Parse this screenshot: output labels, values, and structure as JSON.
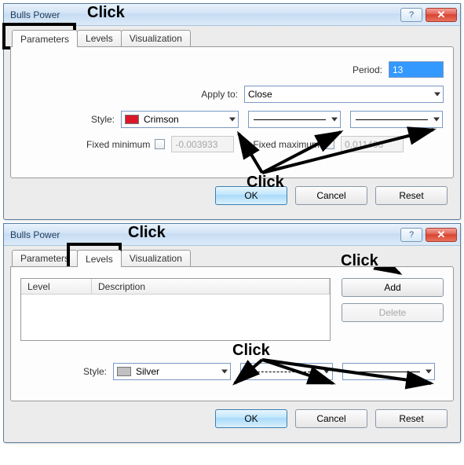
{
  "dialog1": {
    "title": "Bulls Power",
    "tabs": {
      "parameters": "Parameters",
      "levels": "Levels",
      "visualization": "Visualization"
    },
    "period": {
      "label": "Period:",
      "value": "13"
    },
    "apply_to": {
      "label": "Apply to:",
      "value": "Close"
    },
    "style": {
      "label": "Style:",
      "color_name": "Crimson",
      "color_hex": "#d9182a"
    },
    "fixed_min": {
      "label": "Fixed minimum",
      "value": "-0.003933"
    },
    "fixed_max": {
      "label": "Fixed maximum",
      "value": "0.011406"
    },
    "buttons": {
      "ok": "OK",
      "cancel": "Cancel",
      "reset": "Reset"
    }
  },
  "dialog2": {
    "title": "Bulls Power",
    "tabs": {
      "parameters": "Parameters",
      "levels": "Levels",
      "visualization": "Visualization"
    },
    "list_headers": {
      "level": "Level",
      "description": "Description"
    },
    "side_buttons": {
      "add": "Add",
      "delete": "Delete"
    },
    "style": {
      "label": "Style:",
      "color_name": "Silver",
      "color_hex": "#c0c0c0"
    },
    "buttons": {
      "ok": "OK",
      "cancel": "Cancel",
      "reset": "Reset"
    }
  },
  "annotations": {
    "click": "Click"
  }
}
